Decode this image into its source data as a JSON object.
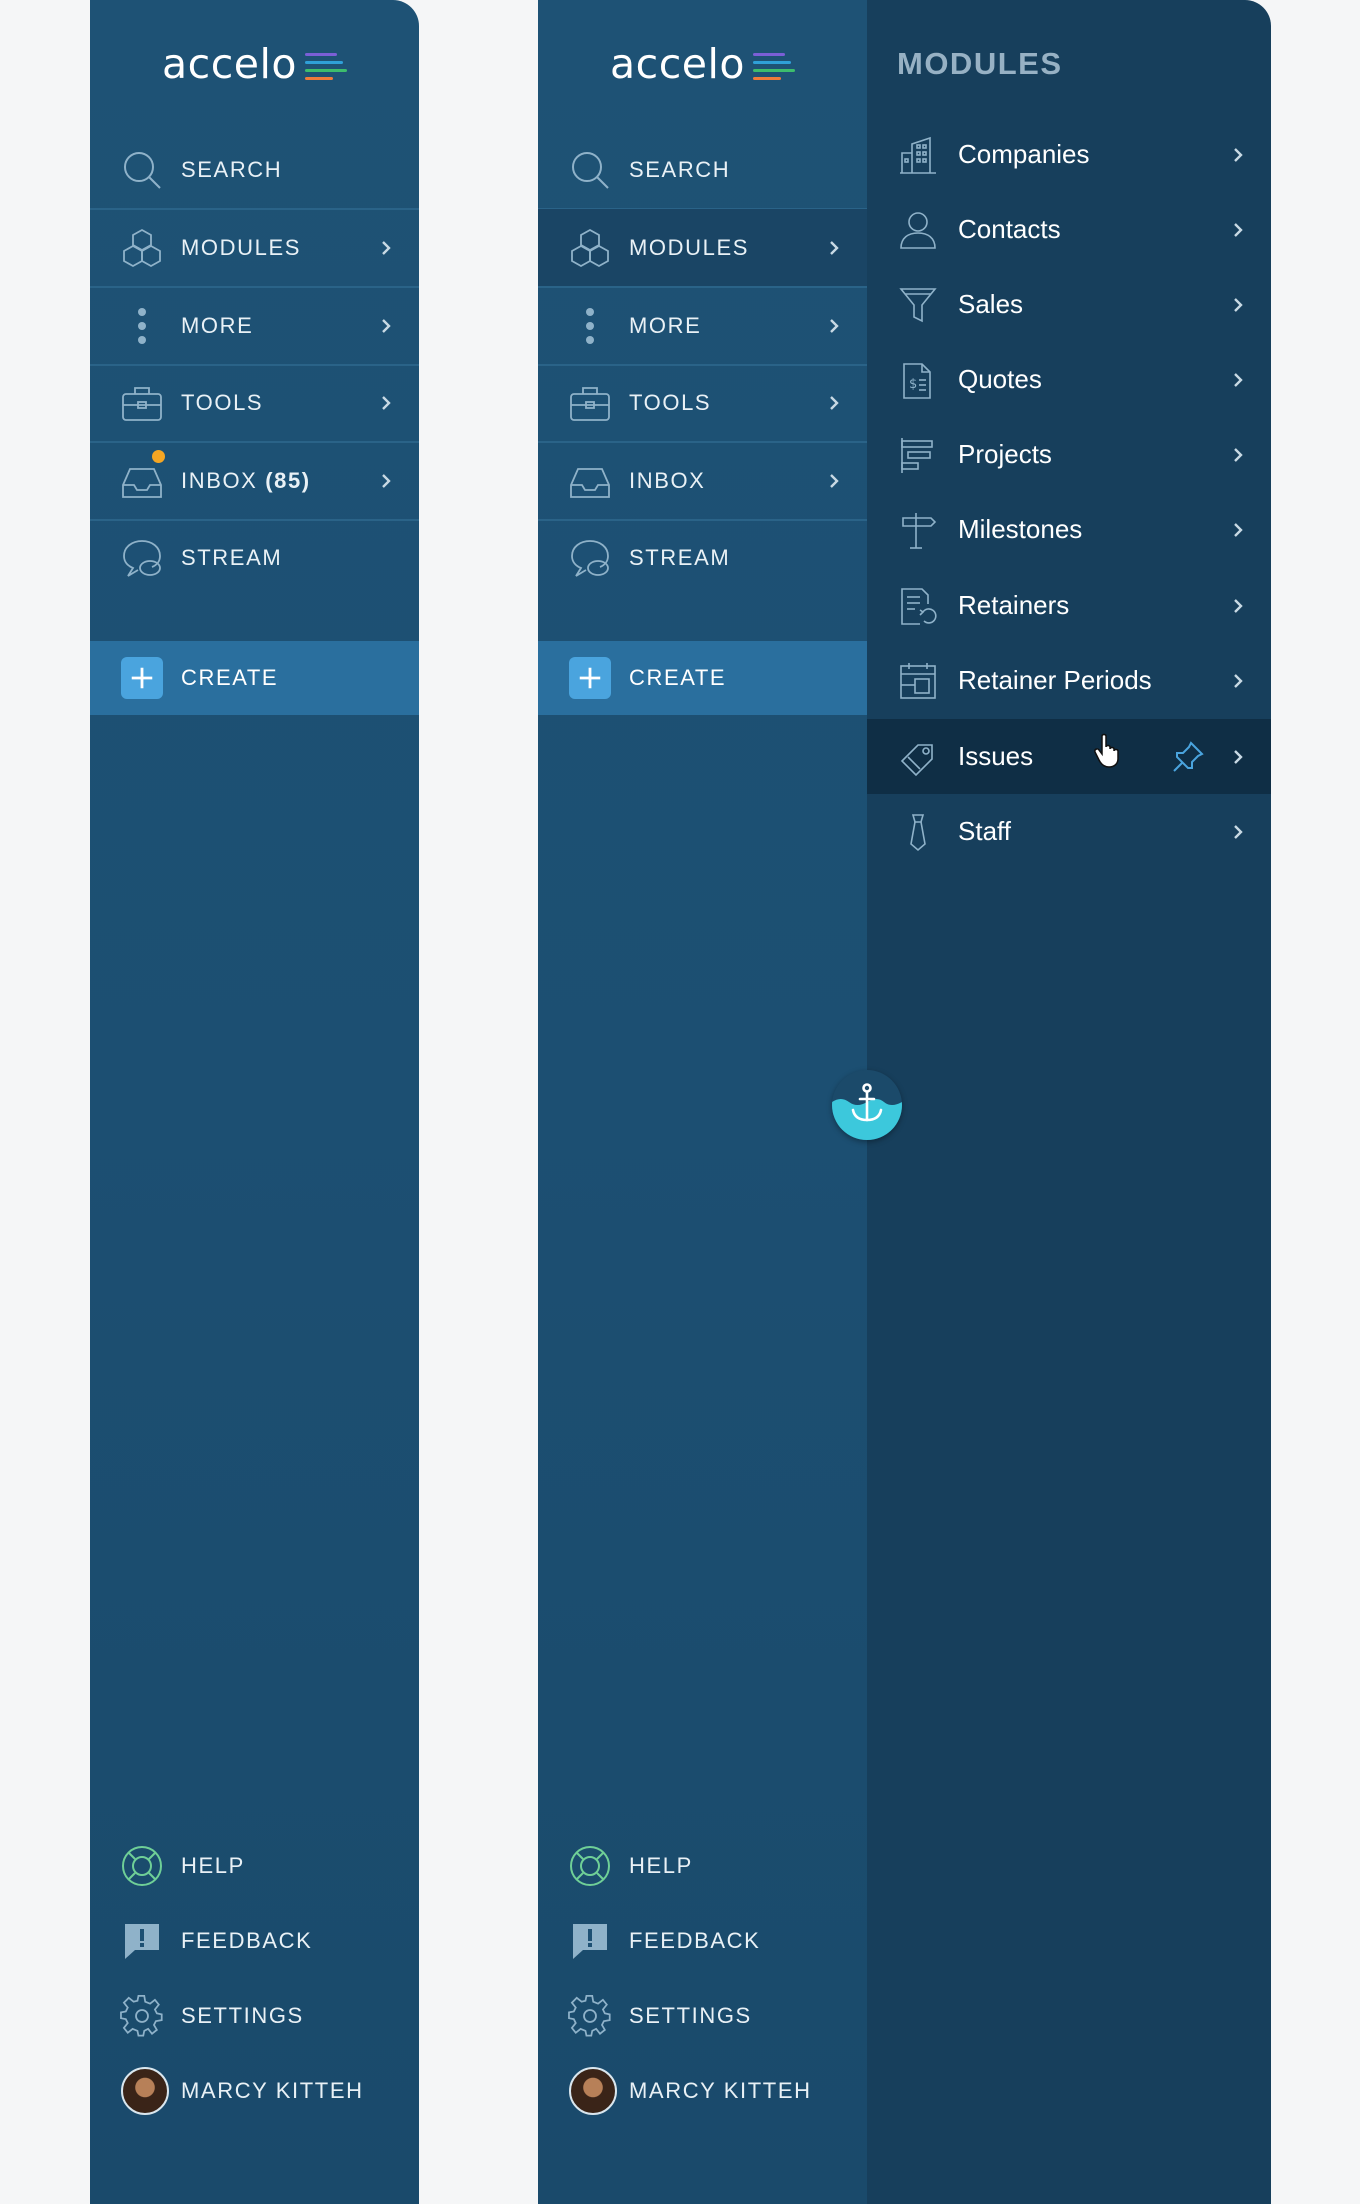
{
  "brand": {
    "logo_text": "accelo",
    "bar_colors": [
      "#7b5fd6",
      "#2fa0d8",
      "#3dbd6d",
      "#f07b3a"
    ]
  },
  "sidebar_collapsed": {
    "nav": [
      {
        "label": "SEARCH",
        "icon": "search-icon"
      },
      {
        "label": "MODULES",
        "icon": "modules-cubes-icon"
      },
      {
        "label": "MORE",
        "icon": "more-dots-icon"
      },
      {
        "label": "TOOLS",
        "icon": "toolbox-icon"
      },
      {
        "label": "INBOX",
        "count": "(85)",
        "icon": "inbox-icon"
      },
      {
        "label": "STREAM",
        "icon": "stream-chat-icon"
      }
    ],
    "create_label": "CREATE",
    "bottom": [
      {
        "label": "HELP",
        "icon": "help-lifebuoy-icon"
      },
      {
        "label": "FEEDBACK",
        "icon": "feedback-icon"
      },
      {
        "label": "SETTINGS",
        "icon": "gear-icon"
      },
      {
        "label": "MARCY KITTEH",
        "icon": "avatar"
      }
    ]
  },
  "sidebar_expanded": {
    "nav": [
      {
        "label": "SEARCH",
        "icon": "search-icon"
      },
      {
        "label": "MODULES",
        "icon": "modules-cubes-icon",
        "selected": true
      },
      {
        "label": "MORE",
        "icon": "more-dots-icon"
      },
      {
        "label": "TOOLS",
        "icon": "toolbox-icon"
      },
      {
        "label": "INBOX",
        "icon": "inbox-icon"
      },
      {
        "label": "STREAM",
        "icon": "stream-chat-icon"
      }
    ],
    "create_label": "CREATE",
    "bottom": [
      {
        "label": "HELP",
        "icon": "help-lifebuoy-icon"
      },
      {
        "label": "FEEDBACK",
        "icon": "feedback-icon"
      },
      {
        "label": "SETTINGS",
        "icon": "gear-icon"
      },
      {
        "label": "MARCY KITTEH",
        "icon": "avatar"
      }
    ]
  },
  "modules_panel": {
    "title": "MODULES",
    "items": [
      {
        "label": "Companies",
        "icon": "building-icon"
      },
      {
        "label": "Contacts",
        "icon": "person-icon"
      },
      {
        "label": "Sales",
        "icon": "funnel-icon"
      },
      {
        "label": "Quotes",
        "icon": "quote-document-icon"
      },
      {
        "label": "Projects",
        "icon": "gantt-icon"
      },
      {
        "label": "Milestones",
        "icon": "signpost-icon"
      },
      {
        "label": "Retainers",
        "icon": "retainer-icon"
      },
      {
        "label": "Retainer Periods",
        "icon": "calendar-period-icon"
      },
      {
        "label": "Issues",
        "icon": "tag-icon",
        "hovered": true,
        "pin_icon": "pin-icon"
      },
      {
        "label": "Staff",
        "icon": "tie-icon"
      }
    ]
  },
  "colors": {
    "sidebar_bg": "#1e5275",
    "panel_bg": "#173f5c",
    "create_bg": "#2a6f9e",
    "accent_blue": "#4aa4de",
    "inbox_badge": "#f5a623",
    "help_icon": "#6fcf97",
    "anchor_water": "#3cc8dc"
  }
}
